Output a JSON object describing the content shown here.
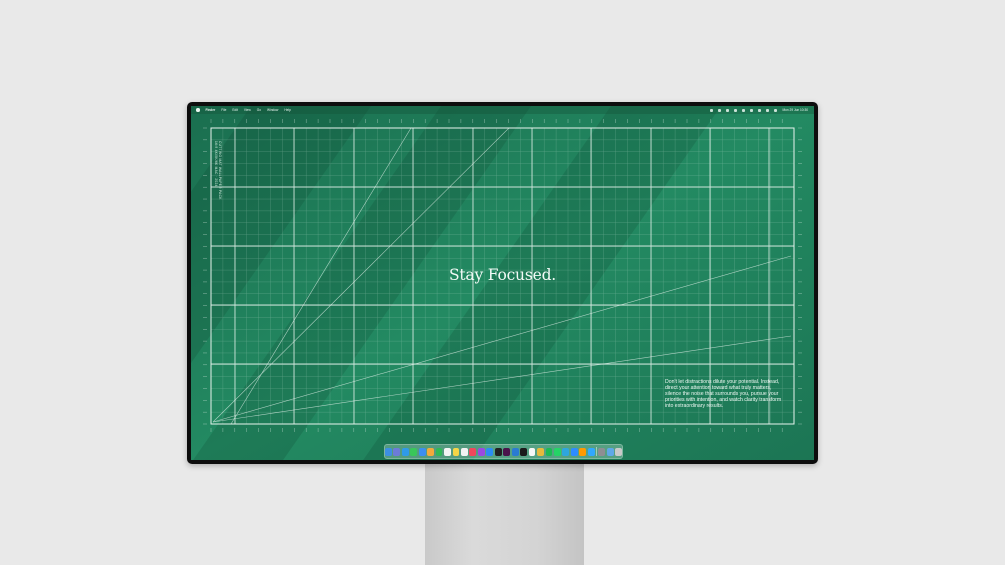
{
  "menubar": {
    "left_items": [
      "Finder",
      "File",
      "Edit",
      "View",
      "Go",
      "Window",
      "Help"
    ],
    "datetime": "Mon 29 Jun 10:30"
  },
  "desktop": {
    "headline": "Stay Focused.",
    "vertical_caption_lines": [
      "CUTTING MAT WALLPAPER PACK",
      "16:9 4K/5K/6K MAC · 2024"
    ],
    "paragraph": "Don't let distractions dilute your potential. Instead, direct your attention toward what truly matters, silence the noise that surrounds you, pursue your priorities with intention, and watch clarity transform into extraordinary results.",
    "accent_color": "#1f7d5a",
    "grid_line_color": "#e8f4ee"
  },
  "dock": {
    "icons": [
      {
        "name": "finder-icon",
        "color": "#3d8fe3"
      },
      {
        "name": "launchpad-icon",
        "color": "#6c7bd8"
      },
      {
        "name": "safari-icon",
        "color": "#2f9ae8"
      },
      {
        "name": "messages-icon",
        "color": "#39c65a"
      },
      {
        "name": "mail-icon",
        "color": "#3b8ef0"
      },
      {
        "name": "photos-icon",
        "color": "#f2a93b"
      },
      {
        "name": "facetime-icon",
        "color": "#2fb855"
      },
      {
        "name": "calendar-icon",
        "color": "#f4f4f4"
      },
      {
        "name": "notes-icon",
        "color": "#f5d546"
      },
      {
        "name": "reminders-icon",
        "color": "#f2f2f2"
      },
      {
        "name": "music-icon",
        "color": "#f0475c"
      },
      {
        "name": "podcasts-icon",
        "color": "#9b4ae0"
      },
      {
        "name": "app-store-icon",
        "color": "#2b8df3"
      },
      {
        "name": "figma-icon",
        "color": "#222222"
      },
      {
        "name": "slack-icon",
        "color": "#4a154b"
      },
      {
        "name": "vscode-icon",
        "color": "#2a7bd3"
      },
      {
        "name": "terminal-icon",
        "color": "#1b1b1b"
      },
      {
        "name": "notion-icon",
        "color": "#f7f7f7"
      },
      {
        "name": "chrome-icon",
        "color": "#e7b93c"
      },
      {
        "name": "spotify-icon",
        "color": "#1db954"
      },
      {
        "name": "whatsapp-icon",
        "color": "#25d366"
      },
      {
        "name": "telegram-icon",
        "color": "#2ea6de"
      },
      {
        "name": "zoom-icon",
        "color": "#2d8cff"
      },
      {
        "name": "illustrator-icon",
        "color": "#ff9a00"
      },
      {
        "name": "photoshop-icon",
        "color": "#31a8ff"
      },
      {
        "name": "system-settings-icon",
        "color": "#8e8e93"
      },
      {
        "name": "downloads-folder-icon",
        "color": "#5fa8e8"
      },
      {
        "name": "trash-icon",
        "color": "#c9c9c9"
      }
    ]
  }
}
